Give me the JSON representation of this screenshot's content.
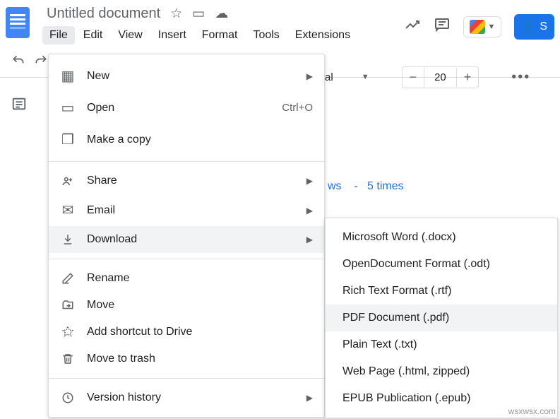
{
  "header": {
    "doc_title": "Untitled document",
    "menus": [
      "File",
      "Edit",
      "View",
      "Insert",
      "Format",
      "Tools",
      "Extensions"
    ],
    "share_label": "S"
  },
  "toolbar": {
    "font": "al",
    "zoom": "20"
  },
  "body_text": {
    "fragment1": "ws",
    "dash": "-",
    "fragment2": "5 times"
  },
  "file_menu": {
    "new": "New",
    "open": "Open",
    "open_shortcut": "Ctrl+O",
    "make_copy": "Make a copy",
    "share": "Share",
    "email": "Email",
    "download": "Download",
    "rename": "Rename",
    "move": "Move",
    "add_shortcut": "Add shortcut to Drive",
    "move_trash": "Move to trash",
    "version_history": "Version history"
  },
  "download_submenu": {
    "docx": "Microsoft Word (.docx)",
    "odt": "OpenDocument Format (.odt)",
    "rtf": "Rich Text Format (.rtf)",
    "pdf": "PDF Document (.pdf)",
    "txt": "Plain Text (.txt)",
    "html": "Web Page (.html, zipped)",
    "epub": "EPUB Publication (.epub)"
  },
  "watermark": "wsxwsx.com"
}
